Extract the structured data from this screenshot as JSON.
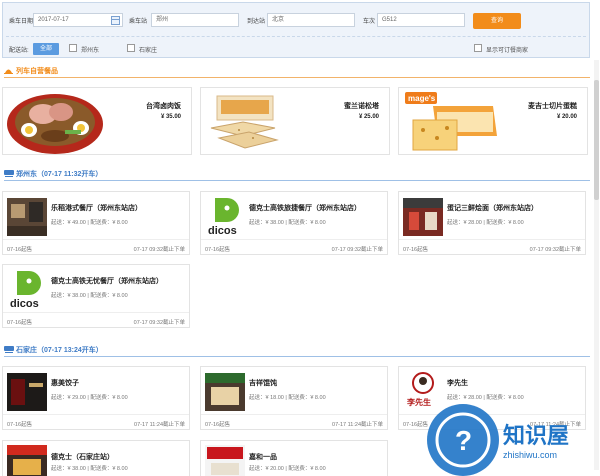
{
  "search": {
    "date_label": "乘车日期",
    "date_value": "2017-07-17",
    "from_label": "乘车站",
    "from_value": "郑州",
    "to_label": "到达站",
    "to_value": "北京",
    "train_label": "车次",
    "train_value": "G512",
    "query_button": "查询",
    "delivery_label": "配送站:",
    "all_chip": "全部",
    "station_zhengzhoudong": "郑州东",
    "station_shijiazhuang": "石家庄",
    "show_only_label": "显示可订餐商家"
  },
  "self_section": {
    "title": "列车自营餐品",
    "color": "#f28c1a",
    "items": [
      {
        "name": "台湾卤肉饭",
        "price": "¥ 35.00"
      },
      {
        "name": "蜜兰诺松塔",
        "price": "¥ 25.00"
      },
      {
        "name": "麦吉士切片蛋糕",
        "price": "¥ 20.00"
      }
    ]
  },
  "zzd_section": {
    "title": "郑州东（07-17 11:32开车）",
    "color": "#3f7cc6",
    "shops": [
      {
        "name": "乐稻港式餐厅（郑州东站店）",
        "info": "起送：¥ 49.00 | 配送费：¥ 8.00",
        "date": "07-16起售",
        "deadline": "07-17 09:32截止下单"
      },
      {
        "name": "德克士高铁旅捷餐厅（郑州东站店）",
        "info": "起送：¥ 38.00 | 配送费：¥ 8.00",
        "date": "07-16起售",
        "deadline": "07-17 09:32截止下单",
        "logo": "dicos"
      },
      {
        "name": "蛋记三鲜烩面（郑州东站店）",
        "info": "起送：¥ 28.00 | 配送费：¥ 8.00",
        "date": "07-16起售",
        "deadline": "07-17 09:32截止下单"
      },
      {
        "name": "德克士高铁无忧餐厅（郑州东站店）",
        "info": "起送：¥ 38.00 | 配送费：¥ 8.00",
        "date": "07-16起售",
        "deadline": "07-17 09:32截止下单",
        "logo": "dicos"
      }
    ]
  },
  "sjz_section": {
    "title": "石家庄（07-17 13:24开车）",
    "color": "#3f7cc6",
    "shops": [
      {
        "name": "惠美饺子",
        "info": "起送：¥ 29.00 | 配送费：¥ 8.00",
        "date": "07-16起售",
        "deadline": "07-17 11:24截止下单"
      },
      {
        "name": "吉祥馄饨",
        "info": "起送：¥ 18.00 | 配送费：¥ 8.00",
        "date": "07-16起售",
        "deadline": "07-17 11:24截止下单"
      },
      {
        "name": "李先生",
        "info": "起送：¥ 28.00 | 配送费：¥ 8.00",
        "date": "07-16起售",
        "deadline": "07-17 11:24截止下单",
        "logo_text": "李先生"
      },
      {
        "name": "德克士（石家庄站）",
        "info": "起送：¥ 38.00 | 配送费：¥ 8.00"
      },
      {
        "name": "嘉和一品",
        "info": "起送：¥ 20.00 | 配送费：¥ 8.00"
      }
    ]
  },
  "watermark": {
    "cn": "知识屋",
    "url": "zhishiwu.com"
  }
}
